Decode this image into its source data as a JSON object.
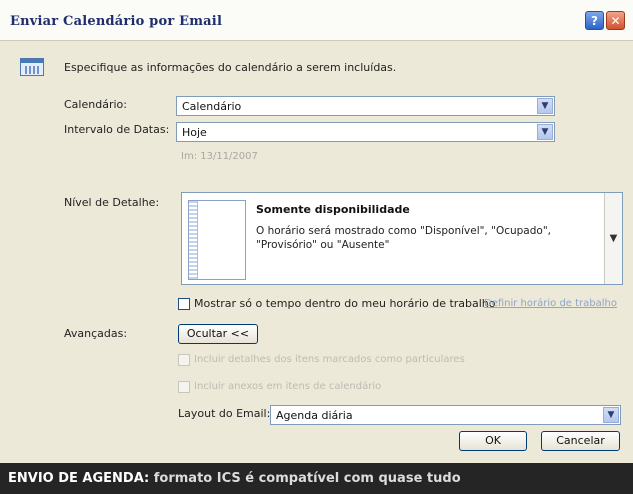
{
  "window": {
    "title": "Enviar Calendário por Email",
    "help_label": "?",
    "close_label": "✕"
  },
  "intro": {
    "icon": "calendar-icon",
    "text": "Especifique as informações do calendário a serem incluídas."
  },
  "calendario": {
    "label": "Calendário:",
    "value": "Calendário"
  },
  "intervalo": {
    "label": "Intervalo de Datas:",
    "value": "Hoje",
    "date_hint": " Im: 13/11/2007"
  },
  "nivel": {
    "label": "Nível de Detalhe:",
    "title": "Somente disponibilidade",
    "description": "O horário será mostrado como \"Disponível\", \"Ocupado\", \"Provisório\" ou \"Ausente\""
  },
  "horario": {
    "checkbox_label": "Mostrar só o tempo dentro do meu horário de trabalho",
    "checked": false,
    "link": "Definir horário de trabalho"
  },
  "avancadas": {
    "label": "Avançadas:",
    "toggle_label": "Ocultar <<",
    "option1": "Incluir detalhes dos itens marcados como particulares",
    "option2": "Incluir anexos em itens de calendário"
  },
  "layout": {
    "label": "Layout do Email:",
    "value": "Agenda diária"
  },
  "buttons": {
    "ok": "OK",
    "cancel": "Cancelar"
  },
  "caption": {
    "highlight": "ENVIO DE AGENDA:",
    "text": "formato ICS é compatível com quase tudo"
  },
  "colors": {
    "title_text": "#1e2d6b",
    "dialog_bg": "#ece9d8",
    "caption_bg": "#252525"
  }
}
